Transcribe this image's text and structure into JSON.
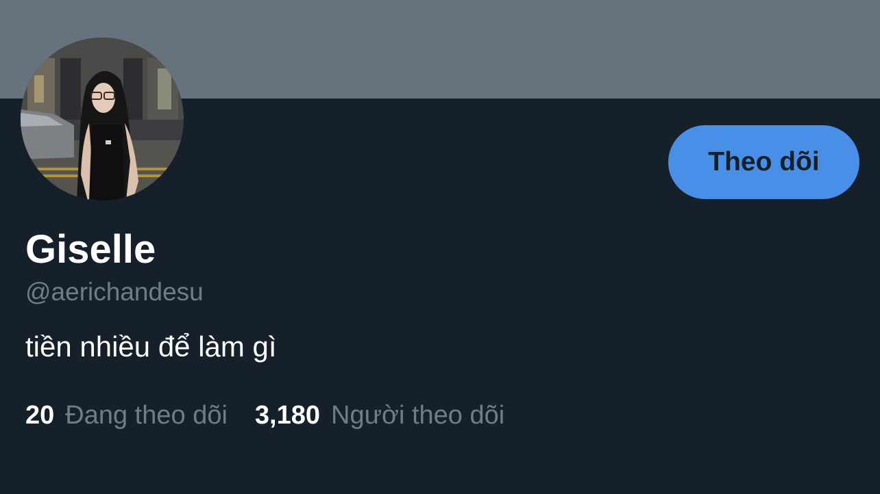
{
  "colors": {
    "banner": "#66737f",
    "background": "#16202b",
    "accent": "#4a8fe7",
    "text_primary": "#ffffff",
    "text_secondary": "#6e7d8c"
  },
  "profile": {
    "display_name": "Giselle",
    "handle": "@aerichandesu",
    "bio": "tiền nhiều để làm gì",
    "avatar_icon": "avatar-photo"
  },
  "actions": {
    "follow_label": "Theo dõi"
  },
  "stats": {
    "following_count": "20",
    "following_label": "Đang theo dõi",
    "followers_count": "3,180",
    "followers_label": "Người theo dõi"
  }
}
